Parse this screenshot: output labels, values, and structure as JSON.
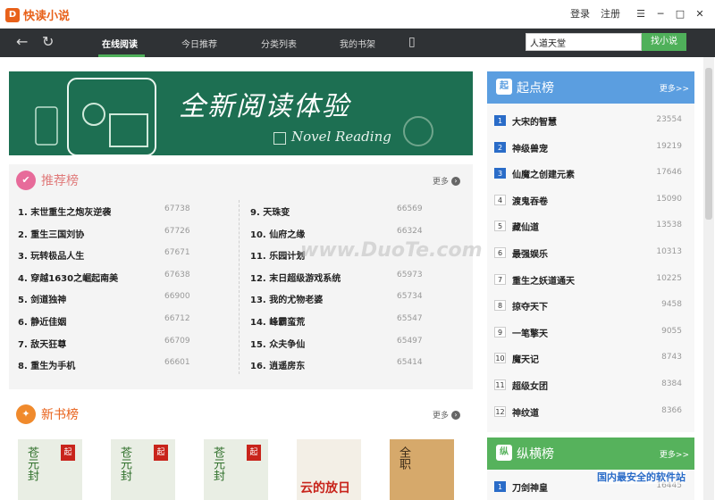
{
  "app": {
    "title": "快读小说"
  },
  "titlebar": {
    "login": "登录",
    "register": "注册"
  },
  "nav": {
    "tabs": [
      {
        "label": "在线阅读",
        "active": true
      },
      {
        "label": "今日推荐",
        "active": false
      },
      {
        "label": "分类列表",
        "active": false
      },
      {
        "label": "我的书架",
        "active": false
      }
    ]
  },
  "search": {
    "value": "人道天堂",
    "button": "找小说"
  },
  "banner": {
    "title": "全新阅读体验",
    "subtitle": "Novel Reading"
  },
  "recommend": {
    "title": "推荐榜",
    "more": "更多",
    "left": [
      {
        "name": "1. 末世重生之炮灰逆袭",
        "num": "67738"
      },
      {
        "name": "2. 重生三国刘协",
        "num": "67726"
      },
      {
        "name": "3. 玩转极品人生",
        "num": "67671"
      },
      {
        "name": "4. 穿越1630之崛起南美",
        "num": "67638"
      },
      {
        "name": "5. 剑道独神",
        "num": "66900"
      },
      {
        "name": "6. 静近佳姻",
        "num": "66712"
      },
      {
        "name": "7. 敌天狂尊",
        "num": "66709"
      },
      {
        "name": "8. 重生为手机",
        "num": "66601"
      }
    ],
    "right": [
      {
        "name": "9. 天珠变",
        "num": "66569"
      },
      {
        "name": "10. 仙府之缘",
        "num": "66324"
      },
      {
        "name": "11. 乐园计划",
        "num": ""
      },
      {
        "name": "12. 末日超级游戏系统",
        "num": "65973"
      },
      {
        "name": "13. 我的尤物老婆",
        "num": "65734"
      },
      {
        "name": "14. 峰霸蛮荒",
        "num": "65547"
      },
      {
        "name": "15. 众夫争仙",
        "num": "65497"
      },
      {
        "name": "16. 逍遥房东",
        "num": "65414"
      }
    ]
  },
  "newbooks": {
    "title": "新书榜",
    "more": "更多",
    "covers": [
      {
        "text": "苍元封",
        "seal": "起"
      },
      {
        "text": "苍元封",
        "seal": "起"
      },
      {
        "text": "苍元封",
        "seal": "起"
      },
      {
        "text": "云的放日",
        "seal": ""
      },
      {
        "text": "全职",
        "seal": ""
      }
    ]
  },
  "qidian": {
    "title": "起点榜",
    "icon": "起",
    "more": "更多>>",
    "items": [
      {
        "rank": "1",
        "name": "大宋的智慧",
        "num": "23554"
      },
      {
        "rank": "2",
        "name": "神级兽宠",
        "num": "19219"
      },
      {
        "rank": "3",
        "name": "仙魔之创建元素",
        "num": "17646"
      },
      {
        "rank": "4",
        "name": "渡鬼吞卷",
        "num": "15090"
      },
      {
        "rank": "5",
        "name": "藏仙道",
        "num": "13538"
      },
      {
        "rank": "6",
        "name": "最强娱乐",
        "num": "10313"
      },
      {
        "rank": "7",
        "name": "重生之妖道通天",
        "num": "10225"
      },
      {
        "rank": "8",
        "name": "掠夺天下",
        "num": "9458"
      },
      {
        "rank": "9",
        "name": "一笔擎天",
        "num": "9055"
      },
      {
        "rank": "10",
        "name": "魔天记",
        "num": "8743"
      },
      {
        "rank": "11",
        "name": "超级女团",
        "num": "8384"
      },
      {
        "rank": "12",
        "name": "神纹道",
        "num": "8366"
      }
    ]
  },
  "zongheng": {
    "title": "纵横榜",
    "icon": "纵",
    "more": "更多>>",
    "items": [
      {
        "rank": "1",
        "name": "刀剑神皇",
        "num": "16445"
      }
    ]
  },
  "watermark": {
    "site": "www.DuoTe.com",
    "corner": "国内最安全的软件站"
  },
  "colors": {
    "accent": "#4fb05a",
    "navbar": "#2f3235",
    "qidian": "#5b9ee0",
    "zongheng": "#56b25c",
    "logo": "#e8611a"
  }
}
